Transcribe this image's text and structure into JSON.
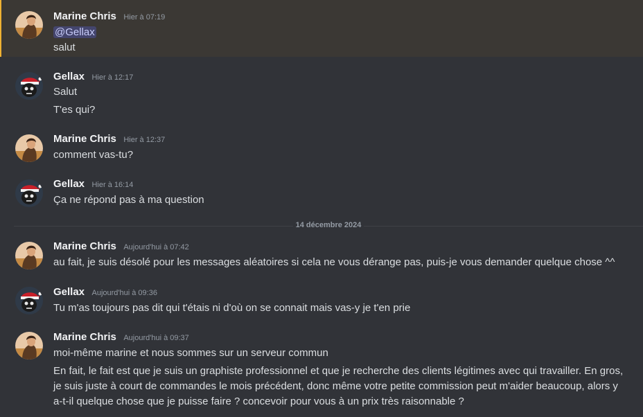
{
  "messages": [
    {
      "author": "Marine Chris",
      "timestamp": "Hier à 07:19",
      "mention": "@Gellax",
      "lines": [
        "salut"
      ]
    },
    {
      "author": "Gellax",
      "timestamp": "Hier à 12:17",
      "lines": [
        "Salut",
        "T'es qui?"
      ]
    },
    {
      "author": "Marine Chris",
      "timestamp": "Hier à 12:37",
      "lines": [
        "comment vas-tu?"
      ]
    },
    {
      "author": "Gellax",
      "timestamp": "Hier à 16:14",
      "lines": [
        "Ça ne répond pas à ma question"
      ]
    },
    {
      "author": "Marine Chris",
      "timestamp": "Aujourd'hui à 07:42",
      "lines": [
        "au fait, je suis désolé pour les messages aléatoires si cela ne vous dérange pas, puis-je vous demander quelque chose ^^"
      ]
    },
    {
      "author": "Gellax",
      "timestamp": "Aujourd'hui à 09:36",
      "lines": [
        "Tu m'as toujours pas dit qui t'étais ni d'où on se connait mais vas-y je t'en prie"
      ]
    },
    {
      "author": "Marine Chris",
      "timestamp": "Aujourd'hui à 09:37",
      "lines": [
        "moi-même marine et nous sommes sur un serveur commun",
        "En fait, le fait est que je suis un graphiste professionnel et que je recherche des clients légitimes avec qui travailler. En gros, je suis juste à court de commandes le mois précédent, donc même votre petite commission peut m'aider beaucoup, alors y a-t-il quelque chose que je puisse faire ? concevoir pour vous à un prix très raisonnable ?"
      ]
    }
  ],
  "date_divider": "14 décembre 2024",
  "colors": {
    "background": "#313338",
    "mention_highlight": "#3b3834",
    "mention_bar": "#f0b232",
    "author": "#f2f3f5",
    "text": "#dbdee1",
    "muted": "#949ba4"
  },
  "avatars": {
    "marine": "woman-portrait-avatar",
    "gellax": "santa-hat-skull-avatar"
  }
}
